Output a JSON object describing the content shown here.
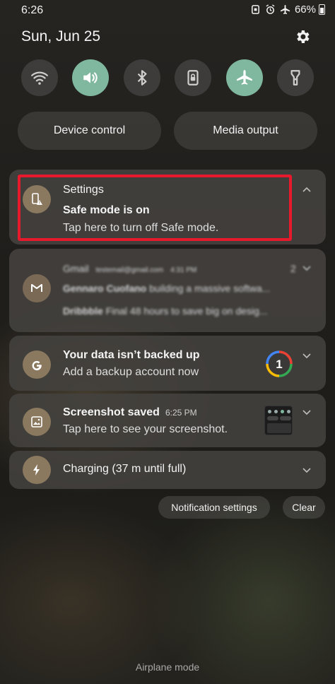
{
  "status_bar": {
    "time": "6:26",
    "battery": "66%"
  },
  "header": {
    "date": "Sun, Jun 25"
  },
  "quick_settings": [
    {
      "name": "wifi-icon",
      "on": false
    },
    {
      "name": "sound-icon",
      "on": true
    },
    {
      "name": "bluetooth-icon",
      "on": false
    },
    {
      "name": "rotation-lock-icon",
      "on": false
    },
    {
      "name": "airplane-icon",
      "on": true
    },
    {
      "name": "flashlight-icon",
      "on": false
    }
  ],
  "pills": {
    "device_control": "Device control",
    "media_output": "Media output"
  },
  "notifications": {
    "settings": {
      "app": "Settings",
      "title": "Safe mode is on",
      "text": "Tap here to turn off Safe mode."
    },
    "gmail": {
      "app": "Gmail",
      "account": "testemail@gmail.com",
      "time": "4:31 PM",
      "count": "2",
      "line1_sender": "Gennaro Cuofano",
      "line1_text": "building a massive softwa...",
      "line2_sender": "Dribbble",
      "line2_text": "Final 48 hours to save big on desig..."
    },
    "backup": {
      "title": "Your data isn’t backed up",
      "text": "Add a backup account now",
      "badge": "1"
    },
    "screenshot": {
      "title": "Screenshot saved",
      "time": "6:25 PM",
      "text": "Tap here to see your screenshot."
    },
    "charging": {
      "title": "Charging (37 m until full)"
    }
  },
  "actions": {
    "notification_settings": "Notification settings",
    "clear": "Clear"
  },
  "footer": {
    "mode_label": "Airplane mode"
  },
  "colors": {
    "toggle_on": "#7fb89e",
    "highlight": "#e8192c",
    "icon_bg": "#8a785f"
  }
}
